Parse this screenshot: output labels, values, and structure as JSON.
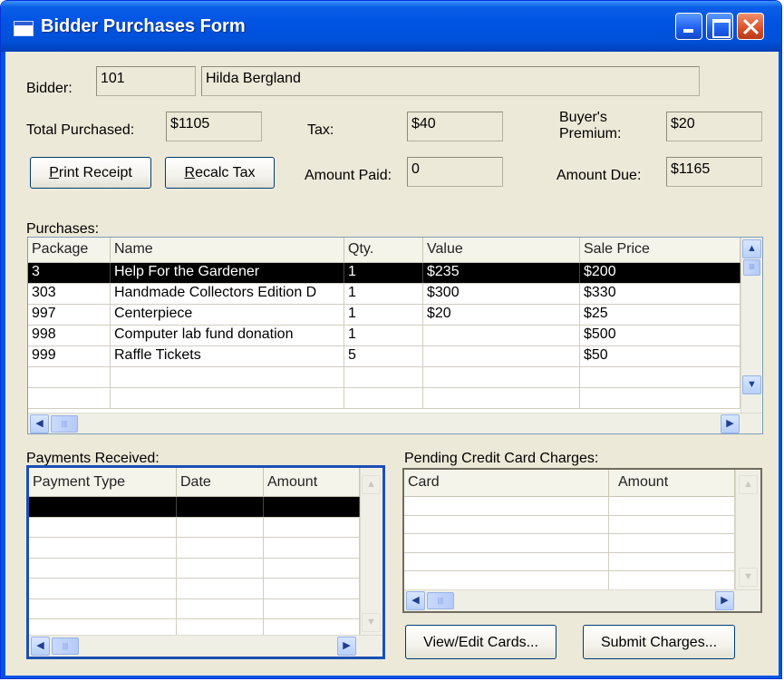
{
  "window": {
    "title": "Bidder Purchases Form"
  },
  "bidder": {
    "label": "Bidder:",
    "number": "101",
    "name": "Hilda Bergland"
  },
  "totals": {
    "total_purchased_label": "Total Purchased:",
    "total_purchased": "$1105",
    "tax_label": "Tax:",
    "tax": "$40",
    "premium_label_line1": "Buyer's",
    "premium_label_line2": "Premium:",
    "premium": "$20",
    "amount_paid_label": "Amount Paid:",
    "amount_paid": "0",
    "amount_due_label": "Amount Due:",
    "amount_due": "$1165"
  },
  "buttons": {
    "print_receipt_hotkey": "P",
    "print_receipt_rest": "rint Receipt",
    "recalc_tax_hotkey": "R",
    "recalc_tax_rest": "ecalc Tax",
    "view_edit_cards": "View/Edit Cards...",
    "submit_charges": "Submit Charges..."
  },
  "purchases": {
    "label": "Purchases:",
    "columns": [
      "Package",
      "Name",
      "Qty.",
      "Value",
      "Sale Price"
    ],
    "rows": [
      {
        "package": "3",
        "name": "Help For the Gardener",
        "qty": "1",
        "value": "$235",
        "sale_price": "$200",
        "selected": true
      },
      {
        "package": "303",
        "name": "Handmade Collectors Edition D",
        "qty": "1",
        "value": "$300",
        "sale_price": "$330"
      },
      {
        "package": "997",
        "name": "Centerpiece",
        "qty": "1",
        "value": "$20",
        "sale_price": "$25"
      },
      {
        "package": "998",
        "name": "Computer lab fund donation",
        "qty": "1",
        "value": "",
        "sale_price": "$500"
      },
      {
        "package": "999",
        "name": "Raffle Tickets",
        "qty": "5",
        "value": "",
        "sale_price": "$50"
      },
      {
        "package": "",
        "name": "",
        "qty": "",
        "value": "",
        "sale_price": ""
      },
      {
        "package": "",
        "name": "",
        "qty": "",
        "value": "",
        "sale_price": ""
      }
    ]
  },
  "payments": {
    "label": "Payments Received:",
    "columns": [
      "Payment Type",
      "Date",
      "Amount"
    ],
    "rows": [
      {
        "payment_type": "",
        "date": "",
        "amount": "",
        "selected": true
      },
      {
        "payment_type": "",
        "date": "",
        "amount": ""
      },
      {
        "payment_type": "",
        "date": "",
        "amount": ""
      },
      {
        "payment_type": "",
        "date": "",
        "amount": ""
      },
      {
        "payment_type": "",
        "date": "",
        "amount": ""
      },
      {
        "payment_type": "",
        "date": "",
        "amount": ""
      },
      {
        "payment_type": "",
        "date": "",
        "amount": ""
      }
    ]
  },
  "pending_charges": {
    "label": "Pending Credit Card Charges:",
    "columns": [
      "Card",
      "Amount"
    ],
    "rows": [
      {
        "card": "",
        "amount": ""
      },
      {
        "card": "",
        "amount": ""
      },
      {
        "card": "",
        "amount": ""
      },
      {
        "card": "",
        "amount": ""
      },
      {
        "card": "",
        "amount": ""
      }
    ]
  }
}
